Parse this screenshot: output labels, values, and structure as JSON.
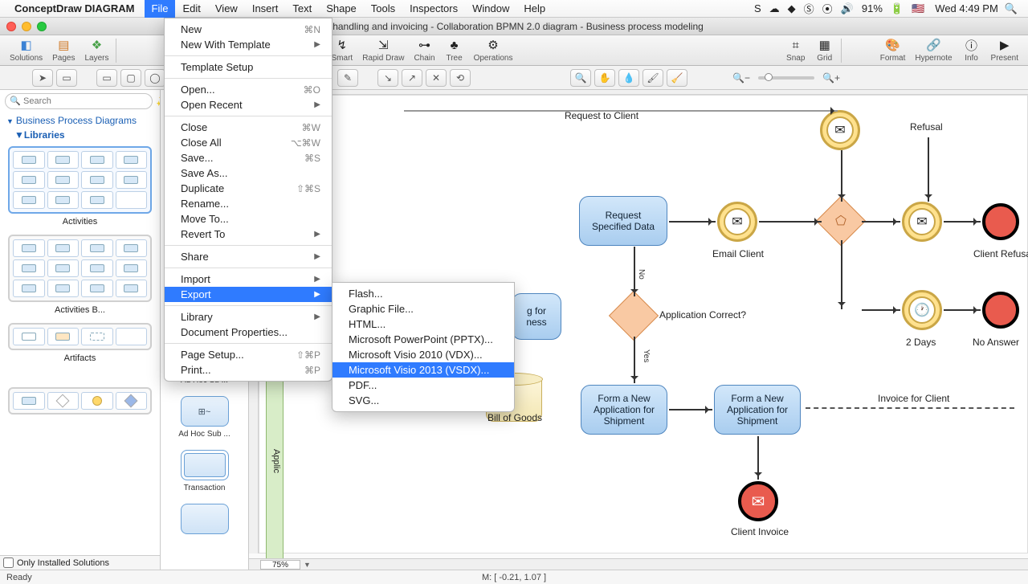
{
  "menubar": {
    "app_name": "ConceptDraw DIAGRAM",
    "items": [
      "File",
      "Edit",
      "View",
      "Insert",
      "Text",
      "Shape",
      "Tools",
      "Inspectors",
      "Window",
      "Help"
    ],
    "active": "File",
    "battery": "91%",
    "clock": "Wed 4:49 PM"
  },
  "window": {
    "title": "n handling and invoicing - Collaboration BPMN 2.0 diagram - Business process modeling"
  },
  "toolbar": {
    "groups_left": [
      {
        "label": "Solutions",
        "icon": "▦"
      },
      {
        "label": "Pages",
        "icon": "▥"
      },
      {
        "label": "Layers",
        "icon": "❖"
      }
    ],
    "groups_mid": [
      {
        "label": "Smart"
      },
      {
        "label": "Rapid Draw"
      },
      {
        "label": "Chain"
      },
      {
        "label": "Tree"
      },
      {
        "label": "Operations"
      }
    ],
    "groups_right1": [
      {
        "label": "Snap"
      },
      {
        "label": "Grid"
      }
    ],
    "groups_right2": [
      {
        "label": "Format"
      },
      {
        "label": "Hypernote"
      },
      {
        "label": "Info"
      },
      {
        "label": "Present"
      }
    ]
  },
  "search": {
    "placeholder": "Search"
  },
  "sidebar": {
    "heading": "Business Process Diagrams",
    "sub": "Libraries",
    "blocks": [
      {
        "label": "Activities",
        "hl": true
      },
      {
        "label": "Activities B...",
        "hl": false
      },
      {
        "label": "Artifacts",
        "hl": false
      }
    ],
    "only_installed": "Only Installed Solutions"
  },
  "shapestrip": {
    "items": [
      {
        "label": "Ad Hoc Su ..."
      },
      {
        "label": "Ad Hoc Sub ...",
        "glyph": "⊞~"
      },
      {
        "label": "Transaction"
      }
    ]
  },
  "file_menu": {
    "items": [
      {
        "t": "New",
        "sc": "⌘N"
      },
      {
        "t": "New With Template",
        "arr": true
      },
      {
        "sep": true
      },
      {
        "t": "Template Setup"
      },
      {
        "sep": true
      },
      {
        "t": "Open...",
        "sc": "⌘O"
      },
      {
        "t": "Open Recent",
        "arr": true
      },
      {
        "sep": true
      },
      {
        "t": "Close",
        "sc": "⌘W"
      },
      {
        "t": "Close All",
        "sc": "⌥⌘W"
      },
      {
        "t": "Save...",
        "sc": "⌘S"
      },
      {
        "t": "Save As...",
        "sc": ""
      },
      {
        "t": "Duplicate",
        "sc": "⇧⌘S"
      },
      {
        "t": "Rename..."
      },
      {
        "t": "Move To..."
      },
      {
        "t": "Revert To",
        "arr": true
      },
      {
        "sep": true
      },
      {
        "t": "Share",
        "arr": true
      },
      {
        "sep": true
      },
      {
        "t": "Import",
        "arr": true
      },
      {
        "t": "Export",
        "arr": true,
        "hl": true
      },
      {
        "sep": true
      },
      {
        "t": "Library",
        "arr": true
      },
      {
        "t": "Document Properties..."
      },
      {
        "sep": true
      },
      {
        "t": "Page Setup...",
        "sc": "⇧⌘P"
      },
      {
        "t": "Print...",
        "sc": "⌘P"
      }
    ]
  },
  "export_submenu": {
    "items": [
      {
        "t": "Flash..."
      },
      {
        "t": "Graphic File..."
      },
      {
        "t": "HTML..."
      },
      {
        "t": "Microsoft PowerPoint (PPTX)..."
      },
      {
        "t": "Microsoft Visio 2010 (VDX)..."
      },
      {
        "t": "Microsoft Visio 2013 (VSDX)...",
        "hl": true
      },
      {
        "t": "PDF..."
      },
      {
        "t": "SVG..."
      }
    ]
  },
  "canvas": {
    "labels": {
      "request_client": "Request to Client",
      "refusal": "Refusal",
      "request_data": "Request Specified Data",
      "email_client": "Email Client",
      "client_refusal": "Client Refusa",
      "two_days": "2 Days",
      "no_answer": "No Answer",
      "app_correct": "Application Correct?",
      "form_app1": "Form a New Application for Shipment",
      "form_app2": "Form a New Application for Shipment",
      "invoice": "Invoice for Client",
      "client_invoice": "Client Invoice",
      "bill_goods": "Bill of Goods",
      "task_frag": "g for\nness",
      "lane": "Applic",
      "edge_no": "No",
      "edge_yes": "Yes"
    }
  },
  "status": {
    "ready": "Ready",
    "coords": "M: [ -0.21, 1.07 ]",
    "zoom": "75%"
  }
}
